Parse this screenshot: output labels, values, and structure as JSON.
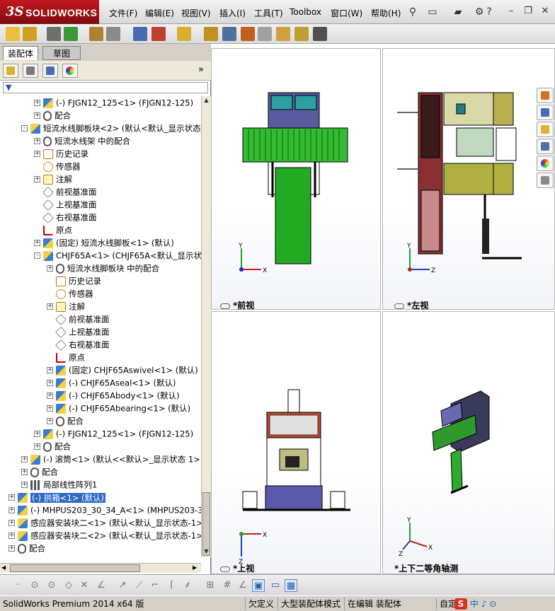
{
  "app": {
    "brand_prefix": "3S",
    "brand_name": "SOLIDWORKS"
  },
  "menu": [
    "文件(F)",
    "编辑(E)",
    "视图(V)",
    "插入(I)",
    "工具(T)",
    "Toolbox",
    "窗口(W)",
    "帮助(H)"
  ],
  "panel": {
    "tabs": [
      "装配体",
      "草图"
    ],
    "tree": [
      {
        "label": "(-) FJGN12_125<1> (FJGN12-125)",
        "indent": 1,
        "icon": "part",
        "toggle": "+"
      },
      {
        "label": "配合",
        "indent": 1,
        "icon": "mate",
        "toggle": "+"
      },
      {
        "label": "短流水线脚板块<2> (默认<默认_显示状态",
        "indent": 0,
        "icon": "asm",
        "toggle": "-"
      },
      {
        "label": "短流水线架 中的配合",
        "indent": 1,
        "icon": "mate",
        "toggle": "+"
      },
      {
        "label": "历史记录",
        "indent": 1,
        "icon": "hist",
        "toggle": "+"
      },
      {
        "label": "传感器",
        "indent": 1,
        "icon": "sensor",
        "toggle": ""
      },
      {
        "label": "注解",
        "indent": 1,
        "icon": "note",
        "toggle": "+"
      },
      {
        "label": "前视基准面",
        "indent": 1,
        "icon": "plane",
        "toggle": ""
      },
      {
        "label": "上视基准面",
        "indent": 1,
        "icon": "plane",
        "toggle": ""
      },
      {
        "label": "右视基准面",
        "indent": 1,
        "icon": "plane",
        "toggle": ""
      },
      {
        "label": "原点",
        "indent": 1,
        "icon": "origin",
        "toggle": ""
      },
      {
        "label": "(固定) 短流水线脚板<1> (默认)",
        "indent": 1,
        "icon": "part",
        "toggle": "+"
      },
      {
        "label": "CHJF65A<1> (CHJF65A<默认_显示状态-",
        "indent": 1,
        "icon": "asm",
        "toggle": "-"
      },
      {
        "label": "短流水线脚板块 中的配合",
        "indent": 2,
        "icon": "mate",
        "toggle": "+"
      },
      {
        "label": "历史记录",
        "indent": 2,
        "icon": "hist",
        "toggle": ""
      },
      {
        "label": "传感器",
        "indent": 2,
        "icon": "sensor",
        "toggle": ""
      },
      {
        "label": "注解",
        "indent": 2,
        "icon": "note",
        "toggle": "+"
      },
      {
        "label": "前视基准面",
        "indent": 2,
        "icon": "plane",
        "toggle": ""
      },
      {
        "label": "上视基准面",
        "indent": 2,
        "icon": "plane",
        "toggle": ""
      },
      {
        "label": "右视基准面",
        "indent": 2,
        "icon": "plane",
        "toggle": ""
      },
      {
        "label": "原点",
        "indent": 2,
        "icon": "origin",
        "toggle": ""
      },
      {
        "label": "(固定) CHJF65Aswivel<1> (默认)",
        "indent": 2,
        "icon": "part",
        "toggle": "+"
      },
      {
        "label": "(-) CHJF65Aseal<1> (默认)",
        "indent": 2,
        "icon": "part",
        "toggle": "+"
      },
      {
        "label": "(-) CHJF65Abody<1> (默认)",
        "indent": 2,
        "icon": "part",
        "toggle": "+"
      },
      {
        "label": "(-) CHJF65Abearing<1> (默认)",
        "indent": 2,
        "icon": "part",
        "toggle": "+"
      },
      {
        "label": "配合",
        "indent": 2,
        "icon": "mate",
        "toggle": "+"
      },
      {
        "label": "(-) FJGN12_125<1> (FJGN12-125)",
        "indent": 1,
        "icon": "part",
        "toggle": "+"
      },
      {
        "label": "配合",
        "indent": 1,
        "icon": "mate",
        "toggle": "+"
      },
      {
        "label": "(-) 滚筒<1> (默认<<默认>_显示状态 1>",
        "indent": 0,
        "icon": "asm",
        "toggle": "+"
      },
      {
        "label": "配合",
        "indent": 0,
        "icon": "mate",
        "toggle": "+"
      },
      {
        "label": "局部线性阵列1",
        "indent": 0,
        "icon": "pattern",
        "toggle": "+"
      },
      {
        "label": "(-) 拱箱<1> (默认)",
        "indent": -1,
        "icon": "part",
        "toggle": "+",
        "selected": true
      },
      {
        "label": "(-) MHPUS203_30_34_A<1> (MHPUS203-30-34-",
        "indent": -1,
        "icon": "part",
        "toggle": "+"
      },
      {
        "label": "感应器安装块二<1> (默认<默认_显示状态-1>",
        "indent": -1,
        "icon": "asm",
        "toggle": "+"
      },
      {
        "label": "感应器安装块二<2> (默认<默认_显示状态-1>",
        "indent": -1,
        "icon": "asm",
        "toggle": "+"
      },
      {
        "label": "配合",
        "indent": -1,
        "icon": "mate",
        "toggle": "+"
      }
    ]
  },
  "viewports": [
    {
      "label": "*前视",
      "axis_a": "Y",
      "axis_b": "X"
    },
    {
      "label": "*左视",
      "axis_a": "Y",
      "axis_b": "Z"
    },
    {
      "label": "*上视",
      "axis_a": "Z",
      "axis_b": "X"
    },
    {
      "label": "*上下二等角轴测",
      "axis_a": "Y",
      "axis_b": "X",
      "axis_c": "Z"
    }
  ],
  "status": {
    "version": "SolidWorks Premium 2014 x64 版",
    "items": [
      "欠定义",
      "大型装配体模式",
      "在编辑 装配体"
    ],
    "custom": "自定"
  }
}
